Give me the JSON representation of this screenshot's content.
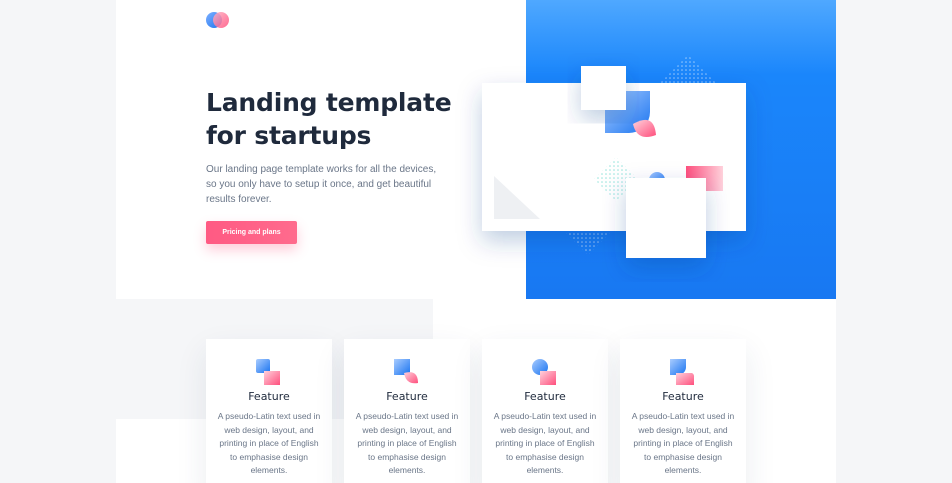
{
  "hero": {
    "title": "Landing template for startups",
    "paragraph": "Our landing page template works for all the devices, so you only have to setup it once, and get beautiful results forever.",
    "cta_label": "Pricing and plans"
  },
  "colors": {
    "accent_blue": "#1a86fb",
    "accent_pink": "#ff5a83",
    "heading": "#1f2a3c",
    "body_text": "#6a7688",
    "page_bg": "#f5f6f8"
  },
  "features": [
    {
      "icon": "feature-shape-1-icon",
      "title": "Feature",
      "text": "A pseudo-Latin text used in web design, layout, and printing in place of English to emphasise design elements."
    },
    {
      "icon": "feature-shape-2-icon",
      "title": "Feature",
      "text": "A pseudo-Latin text used in web design, layout, and printing in place of English to emphasise design elements."
    },
    {
      "icon": "feature-shape-3-icon",
      "title": "Feature",
      "text": "A pseudo-Latin text used in web design, layout, and printing in place of English to emphasise design elements."
    },
    {
      "icon": "feature-shape-4-icon",
      "title": "Feature",
      "text": "A pseudo-Latin text used in web design, layout, and printing in place of English to emphasise design elements."
    }
  ]
}
